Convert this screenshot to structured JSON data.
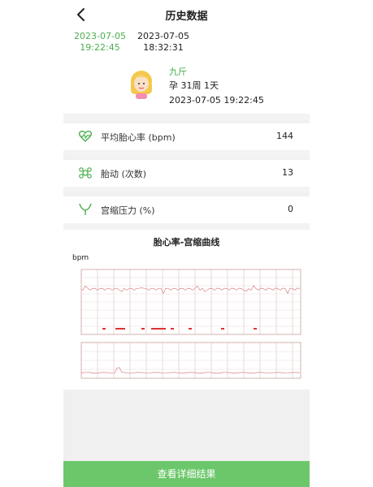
{
  "nav": {
    "title": "历史数据"
  },
  "time_tabs": [
    {
      "date": "2023-07-05",
      "time": "19:22:45"
    },
    {
      "date": "2023-07-05",
      "time": "18:32:31"
    }
  ],
  "profile": {
    "name": "九斤",
    "week": "孕 31周 1天",
    "time": "2023-07-05 19:22:45"
  },
  "stats": [
    {
      "icon": "heart-pulse-icon",
      "label": "平均胎心率 (bpm)",
      "value": "144"
    },
    {
      "icon": "fetal-movement-icon",
      "label": "胎动 (次数)",
      "value": "13"
    },
    {
      "icon": "contraction-icon",
      "label": "宫缩压力 (%)",
      "value": "0"
    }
  ],
  "chart": {
    "title": "胎心率-宫缩曲线",
    "unit_label": "bpm"
  },
  "button": {
    "label": "查看详细结果"
  },
  "colors": {
    "accent": "#4caf50",
    "button": "#6cc76a",
    "grid": "#c9a0a0",
    "trace": "#d98080"
  }
}
